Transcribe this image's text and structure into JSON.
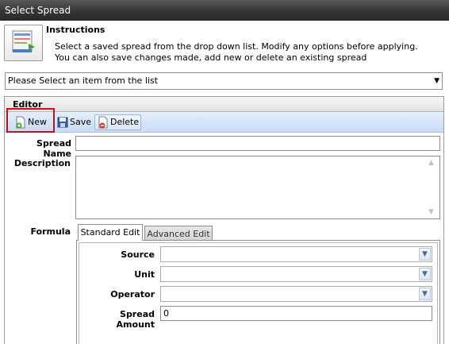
{
  "window": {
    "title": "Select Spread"
  },
  "instructions": {
    "title": "Instructions",
    "text": "Select a saved spread from the drop down list.  Modify any options before applying.  You can also save changes made, add new or delete an existing spread"
  },
  "spread_select": {
    "value": "Please Select an item from the list"
  },
  "editor": {
    "title": "Editor",
    "toolbar": {
      "new_label": "New",
      "save_label": "Save",
      "delete_label": "Delete"
    },
    "spread_name": {
      "label": "Spread Name",
      "value": ""
    },
    "description": {
      "label": "Description",
      "value": ""
    },
    "formula": {
      "label": "Formula",
      "tabs": [
        "Standard Edit",
        "Advanced Edit"
      ],
      "active_tab": "Standard Edit",
      "fields": {
        "source": {
          "label": "Source",
          "value": ""
        },
        "unit": {
          "label": "Unit",
          "value": ""
        },
        "operator": {
          "label": "Operator",
          "value": ""
        },
        "spread_amount": {
          "label": "Spread Amount",
          "value": "0"
        }
      }
    }
  },
  "colors": {
    "title_bar": "#343434",
    "toolbar": "#c8dcf5",
    "highlight": "#c0141b"
  }
}
